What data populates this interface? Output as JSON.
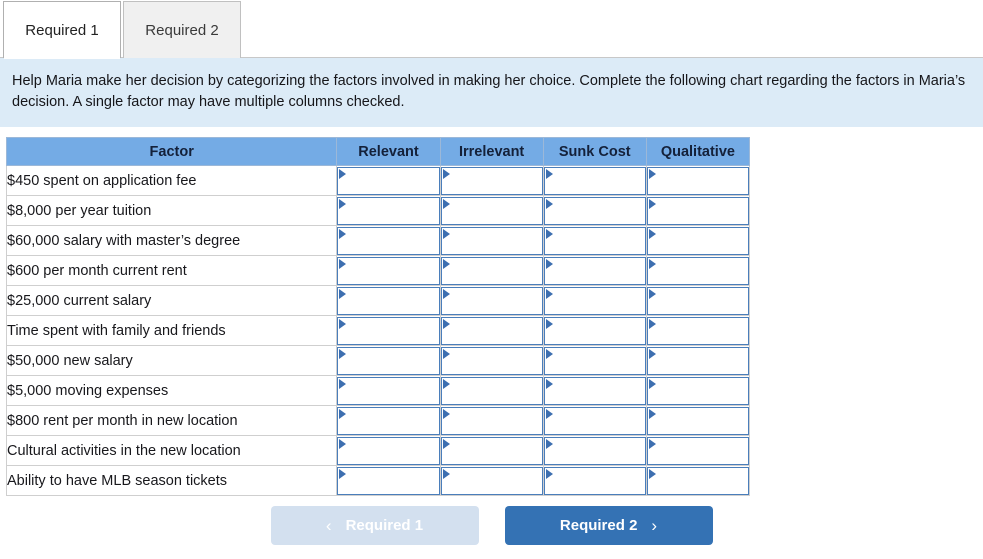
{
  "tabs": [
    {
      "label": "Required 1",
      "active": true
    },
    {
      "label": "Required 2",
      "active": false
    }
  ],
  "instructions": {
    "text": "Help Maria make her decision by categorizing the factors involved in making her choice. Complete the following chart regarding the factors in Maria’s decision. A single factor may have multiple columns checked."
  },
  "table": {
    "headers": [
      "Factor",
      "Relevant",
      "Irrelevant",
      "Sunk Cost",
      "Qualitative"
    ],
    "rows": [
      {
        "factor": "$450 spent on application fee",
        "relevant": "",
        "irrelevant": "",
        "sunk_cost": "",
        "qualitative": ""
      },
      {
        "factor": "$8,000 per year tuition",
        "relevant": "",
        "irrelevant": "",
        "sunk_cost": "",
        "qualitative": ""
      },
      {
        "factor": "$60,000 salary with master’s degree",
        "relevant": "",
        "irrelevant": "",
        "sunk_cost": "",
        "qualitative": ""
      },
      {
        "factor": "$600 per month current rent",
        "relevant": "",
        "irrelevant": "",
        "sunk_cost": "",
        "qualitative": ""
      },
      {
        "factor": "$25,000 current salary",
        "relevant": "",
        "irrelevant": "",
        "sunk_cost": "",
        "qualitative": ""
      },
      {
        "factor": "Time spent with family and friends",
        "relevant": "",
        "irrelevant": "",
        "sunk_cost": "",
        "qualitative": ""
      },
      {
        "factor": "$50,000 new salary",
        "relevant": "",
        "irrelevant": "",
        "sunk_cost": "",
        "qualitative": ""
      },
      {
        "factor": "$5,000 moving expenses",
        "relevant": "",
        "irrelevant": "",
        "sunk_cost": "",
        "qualitative": ""
      },
      {
        "factor": "$800 rent per month in new location",
        "relevant": "",
        "irrelevant": "",
        "sunk_cost": "",
        "qualitative": ""
      },
      {
        "factor": "Cultural activities in the new location",
        "relevant": "",
        "irrelevant": "",
        "sunk_cost": "",
        "qualitative": ""
      },
      {
        "factor": "Ability to have MLB season tickets",
        "relevant": "",
        "irrelevant": "",
        "sunk_cost": "",
        "qualitative": ""
      }
    ]
  },
  "navigation": {
    "prev": {
      "label": "Required 1",
      "icon": "chevron-left-icon",
      "glyph": "‹",
      "enabled": false
    },
    "next": {
      "label": "Required 2",
      "icon": "chevron-right-icon",
      "glyph": "›",
      "enabled": true
    }
  },
  "colors": {
    "header_blue": "#74ABE5",
    "panel_blue": "#DCEBF7",
    "accent_blue": "#3472B4",
    "disabled_blue": "#D3E0EF",
    "cell_border_blue": "#4A7EBB",
    "marker_blue": "#3D6FB0"
  }
}
